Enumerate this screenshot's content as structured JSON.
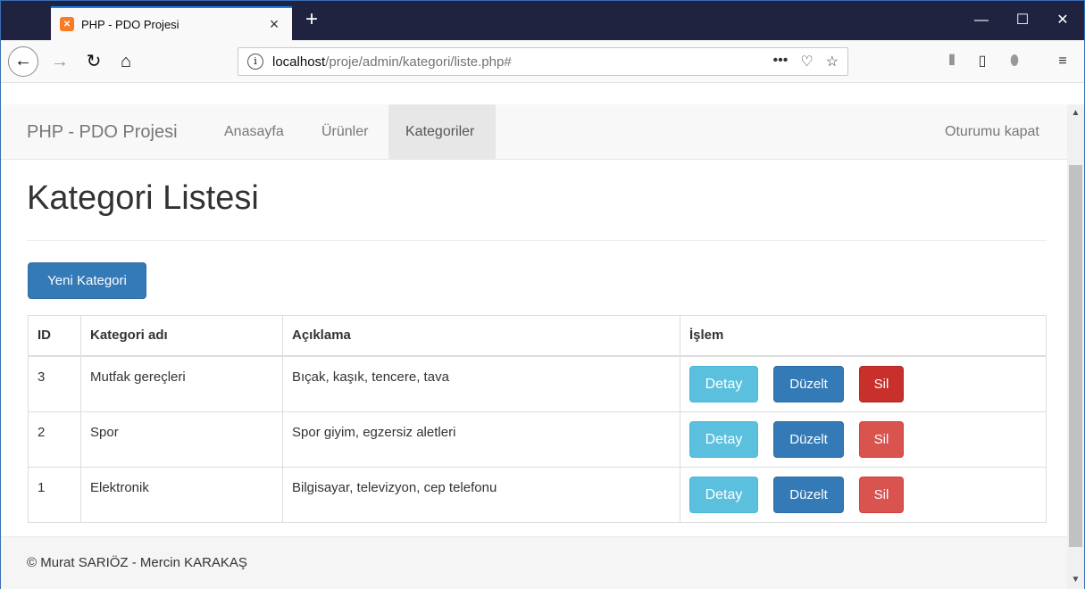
{
  "browser": {
    "tab_title": "PHP - PDO Projesi",
    "favicon_label": "✕",
    "url_host": "localhost",
    "url_path": "/proje/admin/kategori/liste.php#"
  },
  "site": {
    "brand": "PHP - PDO Projesi",
    "nav": [
      "Anasayfa",
      "Ürünler",
      "Kategoriler"
    ],
    "active_nav": "Kategoriler",
    "logout": "Oturumu kapat"
  },
  "page": {
    "title": "Kategori Listesi",
    "new_button": "Yeni Kategori"
  },
  "table": {
    "headers": [
      "ID",
      "Kategori adı",
      "Açıklama",
      "İşlem"
    ],
    "rows": [
      {
        "id": "3",
        "name": "Mutfak gereçleri",
        "desc": "Bıçak, kaşık, tencere, tava"
      },
      {
        "id": "2",
        "name": "Spor",
        "desc": "Spor giyim, egzersiz aletleri"
      },
      {
        "id": "1",
        "name": "Elektronik",
        "desc": "Bilgisayar, televizyon, cep telefonu"
      }
    ],
    "actions": {
      "detail": "Detay",
      "edit": "Düzelt",
      "delete": "Sil"
    }
  },
  "footer": {
    "text": "© Murat SARIÖZ - Mercin KARAKAŞ"
  },
  "colors": {
    "primary": "#337ab7",
    "info": "#5bc0de",
    "danger": "#d9534f",
    "titlebar": "#202340"
  }
}
